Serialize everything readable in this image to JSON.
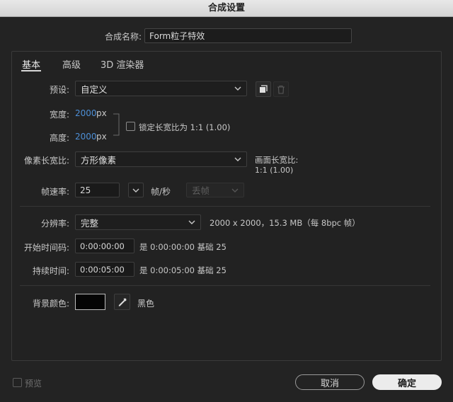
{
  "window": {
    "title": "合成设置"
  },
  "comp_name": {
    "label": "合成名称:",
    "value": "Form粒子特效"
  },
  "tabs": [
    {
      "label": "基本",
      "active": true
    },
    {
      "label": "高级",
      "active": false
    },
    {
      "label": "3D 渲染器",
      "active": false
    }
  ],
  "preset": {
    "label": "预设:",
    "value": "自定义"
  },
  "width": {
    "label": "宽度:",
    "value": "2000",
    "unit": "px"
  },
  "height": {
    "label": "高度:",
    "value": "2000",
    "unit": "px"
  },
  "lock_aspect": {
    "label": "锁定长宽比为 1:1 (1.00)",
    "checked": false
  },
  "pixel_aspect": {
    "label": "像素长宽比:",
    "value": "方形像素"
  },
  "frame_aspect": {
    "label": "画面长宽比:",
    "value": "1:1 (1.00)"
  },
  "frame_rate": {
    "label": "帧速率:",
    "value": "25",
    "unit": "帧/秒",
    "drop_frame": "丢帧"
  },
  "resolution": {
    "label": "分辨率:",
    "value": "完整",
    "info": "2000 x 2000，15.3 MB（每 8bpc 帧）"
  },
  "start_timecode": {
    "label": "开始时间码:",
    "value": "0:00:00:00",
    "info": "是 0:00:00:00  基础 25"
  },
  "duration": {
    "label": "持续时间:",
    "value": "0:00:05:00",
    "info": "是 0:00:05:00  基础 25"
  },
  "bg_color": {
    "label": "背景颜色:",
    "color": "#000000",
    "name": "黑色"
  },
  "preview": {
    "label": "预览"
  },
  "buttons": {
    "cancel": "取消",
    "ok": "确定"
  },
  "colors": {
    "accent_blue": "#4d8fd6",
    "bg": "#232323"
  }
}
